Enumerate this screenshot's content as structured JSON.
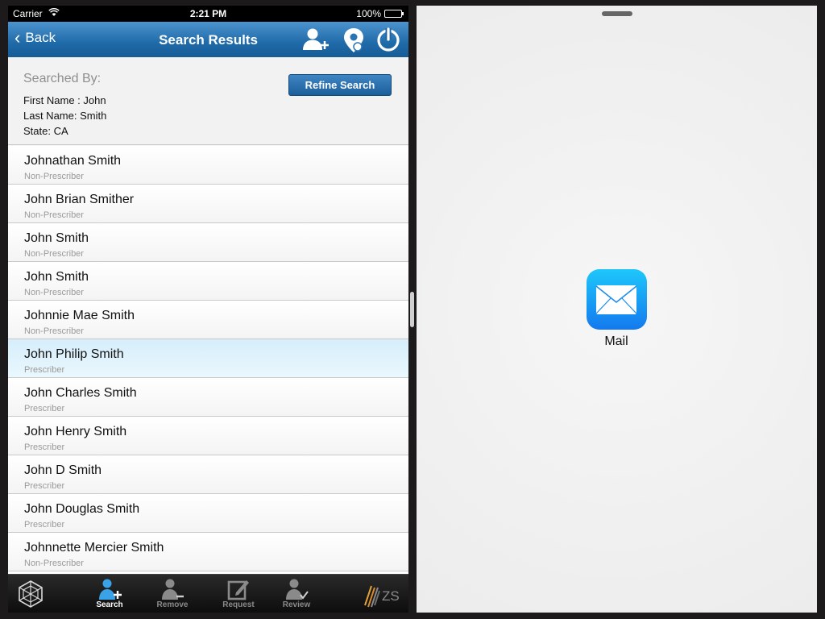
{
  "status_bar": {
    "carrier": "Carrier",
    "time": "2:21 PM",
    "battery": "100%"
  },
  "nav": {
    "back_label": "Back",
    "title": "Search Results"
  },
  "search_summary": {
    "title": "Searched By:",
    "criteria": [
      "First Name : John",
      "Last Name: Smith",
      "State: CA"
    ],
    "refine_label": "Refine Search"
  },
  "results": [
    {
      "name": "Johnathan Smith",
      "type": "Non-Prescriber"
    },
    {
      "name": "John Brian Smither",
      "type": "Non-Prescriber"
    },
    {
      "name": "John Smith",
      "type": "Non-Prescriber"
    },
    {
      "name": "John Smith",
      "type": "Non-Prescriber"
    },
    {
      "name": "Johnnie Mae Smith",
      "type": "Non-Prescriber"
    },
    {
      "name": "John Philip Smith",
      "type": "Prescriber"
    },
    {
      "name": "John Charles Smith",
      "type": "Prescriber"
    },
    {
      "name": "John Henry Smith",
      "type": "Prescriber"
    },
    {
      "name": "John D Smith",
      "type": "Prescriber"
    },
    {
      "name": "John Douglas Smith",
      "type": "Prescriber"
    },
    {
      "name": "Johnnette Mercier Smith",
      "type": "Non-Prescriber"
    }
  ],
  "tabs": [
    {
      "label": "Search",
      "icon": "person-add-icon",
      "active": true
    },
    {
      "label": "Remove",
      "icon": "person-remove-icon"
    },
    {
      "label": "Request",
      "icon": "edit-icon"
    },
    {
      "label": "Review",
      "icon": "person-check-icon"
    }
  ],
  "zs_logo_text": "ZS",
  "right_pane": {
    "app_label": "Mail",
    "app_icon": "mail-icon"
  },
  "colors": {
    "nav_blue": "#1f6aa8",
    "selected_row": "#d6eefb",
    "mail_blue": "#1a9ef5"
  }
}
